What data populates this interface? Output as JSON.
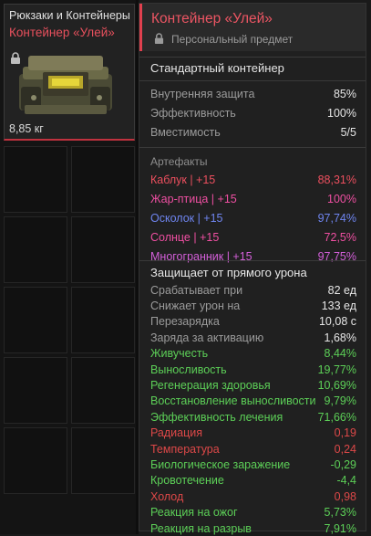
{
  "left_card": {
    "category": "Рюкзаки и Контейнеры",
    "name": "Контейнер «Улей»",
    "weight": "8,85 кг"
  },
  "tooltip": {
    "title": "Контейнер «Улей»",
    "subtitle": "Персональный предмет",
    "type": "Стандартный контейнер",
    "stats": [
      {
        "label": "Внутренняя защита",
        "value": "85%"
      },
      {
        "label": "Эффективность",
        "value": "100%"
      },
      {
        "label": "Вместимость",
        "value": "5/5"
      }
    ],
    "artifacts_heading": "Артефакты",
    "artifacts": [
      {
        "label": "Каблук | +15",
        "value": "88,31%",
        "color": "#ec4f5e"
      },
      {
        "label": "Жар-птица | +15",
        "value": "100%",
        "color": "#ef4fa2"
      },
      {
        "label": "Осколок | +15",
        "value": "97,74%",
        "color": "#6f85f0"
      },
      {
        "label": "Солнце | +15",
        "value": "72,5%",
        "color": "#ef4fa2"
      },
      {
        "label": "Многогранник | +15",
        "value": "97,75%",
        "color": "#d35fd9"
      }
    ],
    "protection_heading": "Защищает от прямого урона",
    "protection": [
      {
        "label": "Срабатывает при",
        "value": "82 ед",
        "tone": "neutral"
      },
      {
        "label": "Снижает урон на",
        "value": "133 ед",
        "tone": "neutral"
      },
      {
        "label": "Перезарядка",
        "value": "10,08 с",
        "tone": "neutral"
      },
      {
        "label": "Заряда за активацию",
        "value": "1,68%",
        "tone": "neutral"
      },
      {
        "label": "Живучесть",
        "value": "8,44%",
        "tone": "good"
      },
      {
        "label": "Выносливость",
        "value": "19,77%",
        "tone": "good"
      },
      {
        "label": "Регенерация здоровья",
        "value": "10,69%",
        "tone": "good"
      },
      {
        "label": "Восстановление выносливости",
        "value": "9,79%",
        "tone": "good"
      },
      {
        "label": "Эффективность лечения",
        "value": "71,66%",
        "tone": "good"
      },
      {
        "label": "Радиация",
        "value": "0,19",
        "tone": "bad"
      },
      {
        "label": "Температура",
        "value": "0,24",
        "tone": "bad"
      },
      {
        "label": "Биологическое заражение",
        "value": "-0,29",
        "tone": "good"
      },
      {
        "label": "Кровотечение",
        "value": "-4,4",
        "tone": "good"
      },
      {
        "label": "Холод",
        "value": "0,98",
        "tone": "bad"
      },
      {
        "label": "Реакция на ожог",
        "value": "5,73%",
        "tone": "good"
      },
      {
        "label": "Реакция на разрыв",
        "value": "7,91%",
        "tone": "good"
      }
    ]
  },
  "colors": {
    "accent": "#e0404e",
    "good": "#5ccf57",
    "bad": "#dd4848"
  }
}
